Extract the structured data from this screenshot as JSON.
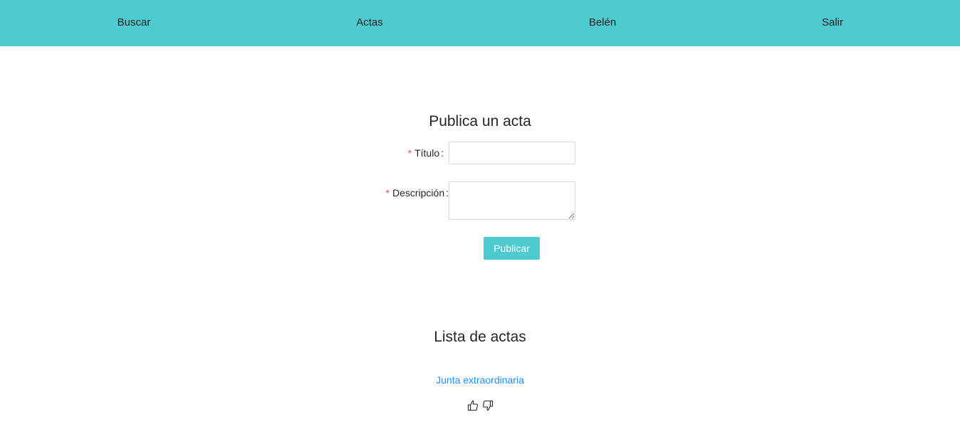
{
  "nav": {
    "items": [
      {
        "label": "Buscar",
        "icon": "search"
      },
      {
        "label": "Actas",
        "icon": "documents"
      },
      {
        "label": "Belén",
        "icon": "user"
      },
      {
        "label": "Salir",
        "icon": "logout"
      }
    ],
    "background_color": "#4ecbd0"
  },
  "publish_form": {
    "title": "Publica un acta",
    "required_mark": "*",
    "colon": ":",
    "fields": {
      "titulo": {
        "label": "Título",
        "value": "",
        "placeholder": ""
      },
      "descripcion": {
        "label": "Descripción",
        "value": "",
        "placeholder": ""
      }
    },
    "submit_label": "Publicar"
  },
  "actas_list": {
    "title": "Lista de actas",
    "items": [
      {
        "title": "Junta extraordinaria",
        "like_icon": "thumbs-up-icon",
        "dislike_icon": "thumbs-down-icon"
      }
    ]
  },
  "colors": {
    "accent": "#4ecbd0",
    "link": "#1890ff",
    "required": "#ff4d4f"
  }
}
